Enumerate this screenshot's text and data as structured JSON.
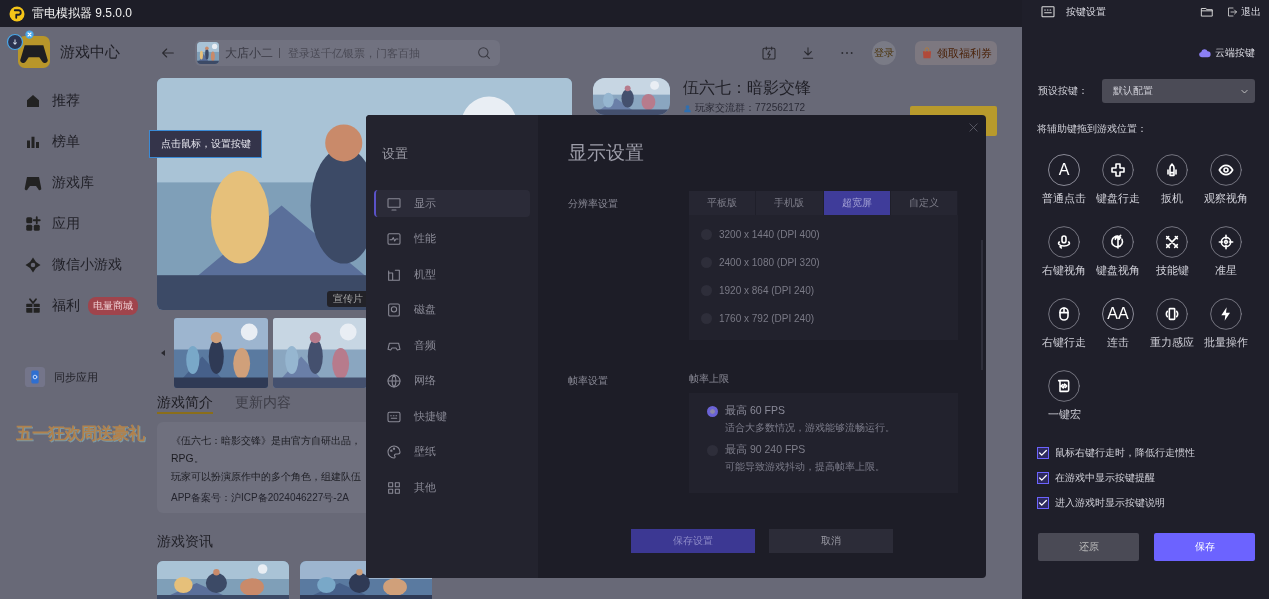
{
  "window": {
    "title": "雷电模拟器 9.5.0.0"
  },
  "sidebar": {
    "title": "游戏中心",
    "items": [
      {
        "label": "推荐",
        "selected": false
      },
      {
        "label": "榜单",
        "selected": false
      },
      {
        "label": "游戏库",
        "selected": false
      },
      {
        "label": "应用",
        "selected": false
      },
      {
        "label": "微信小游戏",
        "selected": false
      },
      {
        "label": "福利",
        "selected": false,
        "badge": "电量商城"
      }
    ],
    "sync": "同步应用",
    "promo": "五一狂欢周送豪礼"
  },
  "topbar": {
    "search": {
      "game": "大店小二",
      "placeholder": "登录送千亿银票，门客百抽"
    },
    "login": "登录",
    "coupon": "领取福利券"
  },
  "banner": {
    "tooltip": "点击鼠标，设置按键",
    "caption": "宣传片"
  },
  "game": {
    "title": "伍六七：暗影交锋",
    "group": "玩家交流群：772562172"
  },
  "tabs": [
    {
      "label": "游戏简介",
      "selected": true
    },
    {
      "label": "更新内容",
      "selected": false
    }
  ],
  "description": {
    "lines": [
      "《伍六七：暗影交锋》是由官方自研出品，",
      "RPG。",
      "玩家可以扮演原作中的多个角色，组建队伍"
    ],
    "record": "APP备案号：沪ICP备2024046227号-2A"
  },
  "news_title": "游戏资讯",
  "settings_dialog": {
    "title": "设置",
    "nav": [
      {
        "label": "显示",
        "selected": true
      },
      {
        "label": "性能",
        "selected": false
      },
      {
        "label": "机型",
        "selected": false
      },
      {
        "label": "磁盘",
        "selected": false
      },
      {
        "label": "音频",
        "selected": false
      },
      {
        "label": "网络",
        "selected": false
      },
      {
        "label": "快捷键",
        "selected": false
      },
      {
        "label": "壁纸",
        "selected": false
      },
      {
        "label": "其他",
        "selected": false
      }
    ],
    "heading": "显示设置",
    "resolution": {
      "label": "分辨率设置",
      "tabs": [
        {
          "label": "平板版",
          "selected": false
        },
        {
          "label": "手机版",
          "selected": false
        },
        {
          "label": "超宽屏",
          "selected": true
        },
        {
          "label": "自定义",
          "selected": false
        }
      ],
      "options": [
        {
          "label": "3200 x 1440 (DPI 400)",
          "selected": false
        },
        {
          "label": "2400 x 1080 (DPI 320)",
          "selected": false
        },
        {
          "label": "1920 x 864 (DPI 240)",
          "selected": false
        },
        {
          "label": "1760 x 792 (DPI 240)",
          "selected": false
        }
      ]
    },
    "framerate": {
      "label": "帧率设置",
      "sublabel": "帧率上限",
      "options": [
        {
          "label": "最高 60 FPS",
          "hint": "适合大多数情况，游戏能够流畅运行。",
          "selected": true
        },
        {
          "label": "最高 90 240 FPS",
          "hint": "可能导致游戏抖动，提高帧率上限。",
          "selected": false
        }
      ]
    },
    "buttons": [
      {
        "label": "保存设置",
        "kind": "primary"
      },
      {
        "label": "取消",
        "kind": "secondary"
      }
    ]
  },
  "key_panel": {
    "title": "按键设置",
    "exit": "退出",
    "cloud": "云端按键",
    "preset": {
      "label": "预设按键：",
      "value": "默认配置"
    },
    "hint": "将辅助键拖到游戏位置：",
    "keys": [
      {
        "label": "普通点击",
        "glyph": "A"
      },
      {
        "label": "键盘行走"
      },
      {
        "label": "扳机"
      },
      {
        "label": "观察视角"
      },
      {
        "label": "右键视角"
      },
      {
        "label": "键盘视角"
      },
      {
        "label": "技能键"
      },
      {
        "label": "准星"
      },
      {
        "label": "右键行走"
      },
      {
        "label": "连击",
        "glyph": "AA"
      },
      {
        "label": "重力感应"
      },
      {
        "label": "批量操作"
      },
      {
        "label": "一键宏"
      }
    ],
    "options": [
      {
        "label": "鼠标右键行走时，降低行走惯性",
        "checked": true
      },
      {
        "label": "在游戏中显示按键提醒",
        "checked": true
      },
      {
        "label": "进入游戏时显示按键说明",
        "checked": true
      }
    ],
    "buttons": [
      {
        "label": "还原",
        "kind": "secondary"
      },
      {
        "label": "保存",
        "kind": "primary"
      }
    ]
  }
}
